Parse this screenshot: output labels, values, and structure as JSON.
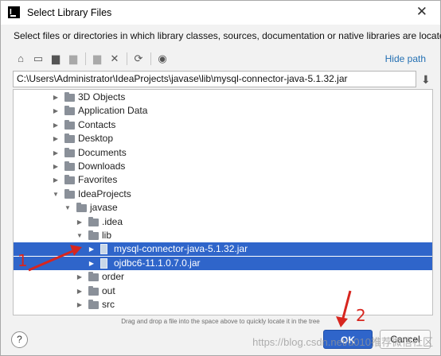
{
  "dialog": {
    "title": "Select Library Files",
    "close_glyph": "✕",
    "description": "Select files or directories in which library classes, sources, documentation or native libraries are located",
    "app_icon_letter": "IJ"
  },
  "toolbar": {
    "icons": [
      "home-icon",
      "desktop-icon",
      "project-folder-icon",
      "module-folder-icon",
      "new-folder-icon",
      "delete-icon",
      "refresh-icon",
      "show-hidden-icon"
    ],
    "hide_path_label": "Hide path"
  },
  "path": {
    "value": "C:\\Users\\Administrator\\IdeaProjects\\javase\\lib\\mysql-connector-java-5.1.32.jar"
  },
  "tree": {
    "rows": [
      {
        "label": "3D Objects",
        "type": "folder",
        "expanded": false,
        "level": 0
      },
      {
        "label": "Application Data",
        "type": "folder",
        "expanded": false,
        "level": 0
      },
      {
        "label": "Contacts",
        "type": "folder",
        "expanded": false,
        "level": 0
      },
      {
        "label": "Desktop",
        "type": "folder",
        "expanded": false,
        "level": 0
      },
      {
        "label": "Documents",
        "type": "folder",
        "expanded": false,
        "level": 0
      },
      {
        "label": "Downloads",
        "type": "folder",
        "expanded": false,
        "level": 0
      },
      {
        "label": "Favorites",
        "type": "folder",
        "expanded": false,
        "level": 0
      },
      {
        "label": "IdeaProjects",
        "type": "folder",
        "expanded": true,
        "level": 0
      },
      {
        "label": "javase",
        "type": "folder",
        "expanded": true,
        "level": 1
      },
      {
        "label": ".idea",
        "type": "folder",
        "expanded": false,
        "level": 2
      },
      {
        "label": "lib",
        "type": "folder",
        "expanded": true,
        "level": 2
      },
      {
        "label": "mysql-connector-java-5.1.32.jar",
        "type": "jar",
        "expanded": false,
        "level": 3,
        "selected": true
      },
      {
        "label": "ojdbc6-11.1.0.7.0.jar",
        "type": "jar",
        "expanded": false,
        "level": 3,
        "selected": true
      },
      {
        "label": "order",
        "type": "folder",
        "expanded": false,
        "level": 2
      },
      {
        "label": "out",
        "type": "folder",
        "expanded": false,
        "level": 2
      },
      {
        "label": "src",
        "type": "folder",
        "expanded": false,
        "level": 2
      }
    ]
  },
  "hint": "Drag and drop a file into the space above to quickly locate it in the tree",
  "buttons": {
    "help": "?",
    "ok": "OK",
    "cancel": "Cancel"
  },
  "annotations": {
    "marker_1": "1",
    "marker_2": "2",
    "color": "#d7261f"
  },
  "watermark": "https://blog.csdn.net/u010推荐微信社区",
  "colors": {
    "selection": "#2f65ca",
    "link": "#2470b3"
  }
}
